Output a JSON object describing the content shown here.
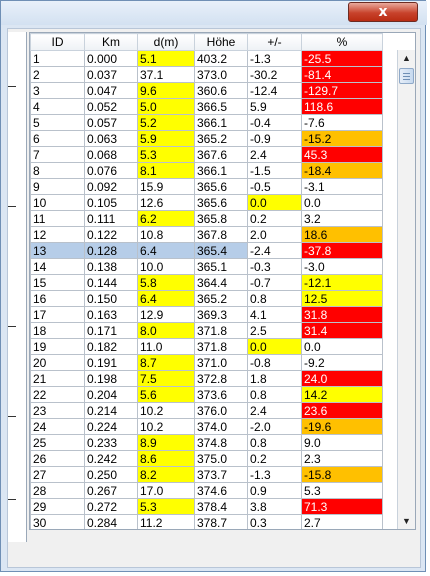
{
  "window": {
    "close_label": "x"
  },
  "table": {
    "columns": [
      "ID",
      "Km",
      "d(m)",
      "Höhe",
      "+/-",
      "%"
    ],
    "selected_id": "13",
    "rows": [
      {
        "id": "1",
        "km": "0.000",
        "d": "5.1",
        "h": "403.2",
        "pm": "-1.3",
        "pct": "-25.5",
        "dc": "y",
        "pc": "r",
        "pmc": ""
      },
      {
        "id": "2",
        "km": "0.037",
        "d": "37.1",
        "h": "373.0",
        "pm": "-30.2",
        "pct": "-81.4",
        "dc": "",
        "pc": "r",
        "pmc": ""
      },
      {
        "id": "3",
        "km": "0.047",
        "d": "9.6",
        "h": "360.6",
        "pm": "-12.4",
        "pct": "-129.7",
        "dc": "y",
        "pc": "r",
        "pmc": ""
      },
      {
        "id": "4",
        "km": "0.052",
        "d": "5.0",
        "h": "366.5",
        "pm": "5.9",
        "pct": "118.6",
        "dc": "y",
        "pc": "r",
        "pmc": ""
      },
      {
        "id": "5",
        "km": "0.057",
        "d": "5.2",
        "h": "366.1",
        "pm": "-0.4",
        "pct": "-7.6",
        "dc": "y",
        "pc": "",
        "pmc": ""
      },
      {
        "id": "6",
        "km": "0.063",
        "d": "5.9",
        "h": "365.2",
        "pm": "-0.9",
        "pct": "-15.2",
        "dc": "y",
        "pc": "o",
        "pmc": ""
      },
      {
        "id": "7",
        "km": "0.068",
        "d": "5.3",
        "h": "367.6",
        "pm": "2.4",
        "pct": "45.3",
        "dc": "y",
        "pc": "r",
        "pmc": ""
      },
      {
        "id": "8",
        "km": "0.076",
        "d": "8.1",
        "h": "366.1",
        "pm": "-1.5",
        "pct": "-18.4",
        "dc": "y",
        "pc": "o",
        "pmc": ""
      },
      {
        "id": "9",
        "km": "0.092",
        "d": "15.9",
        "h": "365.6",
        "pm": "-0.5",
        "pct": "-3.1",
        "dc": "",
        "pc": "",
        "pmc": ""
      },
      {
        "id": "10",
        "km": "0.105",
        "d": "12.6",
        "h": "365.6",
        "pm": "0.0",
        "pct": "0.0",
        "dc": "",
        "pc": "",
        "pmc": "y"
      },
      {
        "id": "11",
        "km": "0.111",
        "d": "6.2",
        "h": "365.8",
        "pm": "0.2",
        "pct": "3.2",
        "dc": "y",
        "pc": "",
        "pmc": ""
      },
      {
        "id": "12",
        "km": "0.122",
        "d": "10.8",
        "h": "367.8",
        "pm": "2.0",
        "pct": "18.6",
        "dc": "",
        "pc": "o",
        "pmc": ""
      },
      {
        "id": "13",
        "km": "0.128",
        "d": "6.4",
        "h": "365.4",
        "pm": "-2.4",
        "pct": "-37.8",
        "dc": "y",
        "pc": "r",
        "pmc": ""
      },
      {
        "id": "14",
        "km": "0.138",
        "d": "10.0",
        "h": "365.1",
        "pm": "-0.3",
        "pct": "-3.0",
        "dc": "",
        "pc": "",
        "pmc": ""
      },
      {
        "id": "15",
        "km": "0.144",
        "d": "5.8",
        "h": "364.4",
        "pm": "-0.7",
        "pct": "-12.1",
        "dc": "y",
        "pc": "y",
        "pmc": ""
      },
      {
        "id": "16",
        "km": "0.150",
        "d": "6.4",
        "h": "365.2",
        "pm": "0.8",
        "pct": "12.5",
        "dc": "y",
        "pc": "y",
        "pmc": ""
      },
      {
        "id": "17",
        "km": "0.163",
        "d": "12.9",
        "h": "369.3",
        "pm": "4.1",
        "pct": "31.8",
        "dc": "",
        "pc": "r",
        "pmc": ""
      },
      {
        "id": "18",
        "km": "0.171",
        "d": "8.0",
        "h": "371.8",
        "pm": "2.5",
        "pct": "31.4",
        "dc": "y",
        "pc": "r",
        "pmc": ""
      },
      {
        "id": "19",
        "km": "0.182",
        "d": "11.0",
        "h": "371.8",
        "pm": "0.0",
        "pct": "0.0",
        "dc": "",
        "pc": "",
        "pmc": "y"
      },
      {
        "id": "20",
        "km": "0.191",
        "d": "8.7",
        "h": "371.0",
        "pm": "-0.8",
        "pct": "-9.2",
        "dc": "y",
        "pc": "",
        "pmc": ""
      },
      {
        "id": "21",
        "km": "0.198",
        "d": "7.5",
        "h": "372.8",
        "pm": "1.8",
        "pct": "24.0",
        "dc": "y",
        "pc": "r",
        "pmc": ""
      },
      {
        "id": "22",
        "km": "0.204",
        "d": "5.6",
        "h": "373.6",
        "pm": "0.8",
        "pct": "14.2",
        "dc": "y",
        "pc": "y",
        "pmc": ""
      },
      {
        "id": "23",
        "km": "0.214",
        "d": "10.2",
        "h": "376.0",
        "pm": "2.4",
        "pct": "23.6",
        "dc": "",
        "pc": "r",
        "pmc": ""
      },
      {
        "id": "24",
        "km": "0.224",
        "d": "10.2",
        "h": "374.0",
        "pm": "-2.0",
        "pct": "-19.6",
        "dc": "",
        "pc": "o",
        "pmc": ""
      },
      {
        "id": "25",
        "km": "0.233",
        "d": "8.9",
        "h": "374.8",
        "pm": "0.8",
        "pct": "9.0",
        "dc": "y",
        "pc": "",
        "pmc": ""
      },
      {
        "id": "26",
        "km": "0.242",
        "d": "8.6",
        "h": "375.0",
        "pm": "0.2",
        "pct": "2.3",
        "dc": "y",
        "pc": "",
        "pmc": ""
      },
      {
        "id": "27",
        "km": "0.250",
        "d": "8.2",
        "h": "373.7",
        "pm": "-1.3",
        "pct": "-15.8",
        "dc": "y",
        "pc": "o",
        "pmc": ""
      },
      {
        "id": "28",
        "km": "0.267",
        "d": "17.0",
        "h": "374.6",
        "pm": "0.9",
        "pct": "5.3",
        "dc": "",
        "pc": "",
        "pmc": ""
      },
      {
        "id": "29",
        "km": "0.272",
        "d": "5.3",
        "h": "378.4",
        "pm": "3.8",
        "pct": "71.3",
        "dc": "y",
        "pc": "r",
        "pmc": ""
      },
      {
        "id": "30",
        "km": "0.284",
        "d": "11.2",
        "h": "378.7",
        "pm": "0.3",
        "pct": "2.7",
        "dc": "",
        "pc": "",
        "pmc": ""
      }
    ]
  },
  "colors": {
    "yellow": "#ffff00",
    "orange": "#ffc000",
    "red": "#ff0000",
    "selection": "#b6cde8"
  },
  "icons": {
    "scroll_up": "triangle-up-icon",
    "scroll_down": "triangle-down-icon"
  }
}
